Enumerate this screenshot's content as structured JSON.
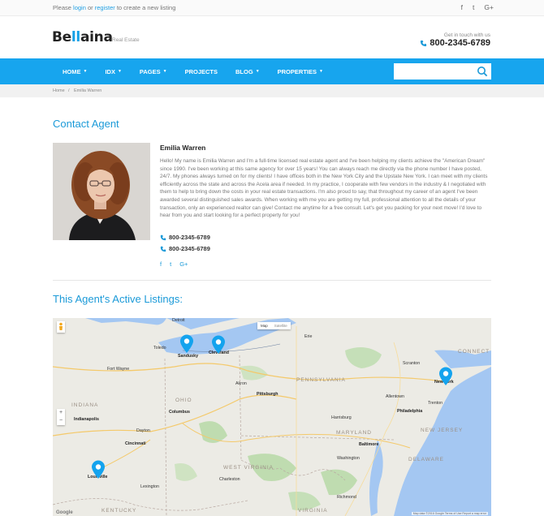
{
  "topbar": {
    "prefix": "Please ",
    "login": "login",
    "or": " or ",
    "register": "register",
    "suffix": " to create a new listing",
    "social": [
      "f",
      "t",
      "G+"
    ]
  },
  "header": {
    "logo_pre": "Be",
    "logo_accent": "ll",
    "logo_post": "aina",
    "logo_sub": "Real Estate",
    "contact_label": "Get in touch with us",
    "contact_phone": "800-2345-6789"
  },
  "nav": {
    "items": [
      {
        "label": "HOME",
        "caret": true
      },
      {
        "label": "IDX",
        "caret": true
      },
      {
        "label": "PAGES",
        "caret": true
      },
      {
        "label": "PROJECTS",
        "caret": false
      },
      {
        "label": "BLOG",
        "caret": true
      },
      {
        "label": "PROPERTIES",
        "caret": true
      }
    ],
    "search_placeholder": ""
  },
  "breadcrumb": [
    "Home",
    "/",
    "Emilia Warren"
  ],
  "contact_title": "Contact Agent",
  "agent": {
    "name": "Emilia Warren",
    "bio": "Hello! My name is Emilia Warren and I'm a full-time licensed real estate agent and I've been helping my clients achieve the \"American Dream\" since 1990. I've been working at this same agency for over 15 years! You can always reach me directly via the phone number I have posted, 24/7. My phones always turned on for my clients! I have offices both in the New York City and the Upstate New York. I can meet with my clients efficiently across the state and across the Acela area if needed. In my practice, I cooperate with few vendors in the industry & I negotiated with them to help to bring down the costs in your real estate transactions. I'm also proud to say, that throughout my career of an agent I've been awarded several distinguished sales awards. When working with me you are getting my full, professional attention to all the details of your transaction, only an experienced realtor can give! Contact me anytime for a free consult. Let's get you packing for your next move! I'd love to hear from you and start looking for a perfect property for you!",
    "phones": [
      "800-2345-6789",
      "800-2345-6789"
    ],
    "social": [
      "f",
      "t",
      "G+"
    ]
  },
  "listings_title": "This Agent's Active Listings:",
  "map": {
    "type_buttons": [
      "Map",
      "Satellite"
    ],
    "zoom": [
      "+",
      "−"
    ],
    "google": "Google",
    "attribution": "Map data ©2016 Google   Terms of Use   Report a map error",
    "states": [
      "PENNSYLVANIA",
      "OHIO",
      "INDIANA",
      "MARYLAND",
      "WEST VIRGINIA",
      "VIRGINIA",
      "KENTUCKY",
      "NEW JERSEY",
      "DELAWARE",
      "CONNECT"
    ],
    "cities": [
      "Detroit",
      "Toledo",
      "Sandusky",
      "Cleveland",
      "Pittsburgh",
      "Columbus",
      "Indianapolis",
      "Cincinnati",
      "Louisville",
      "Philadelphia",
      "New York",
      "Baltimore",
      "Harrisburg",
      "Richmond",
      "Dayton",
      "Fort Wayne",
      "Akron",
      "Scranton",
      "Allentown",
      "Trenton",
      "Washington",
      "Lexington",
      "Charleston",
      "Erie"
    ],
    "pins": [
      "Sandusky",
      "Cleveland",
      "New York",
      "Louisville"
    ]
  }
}
